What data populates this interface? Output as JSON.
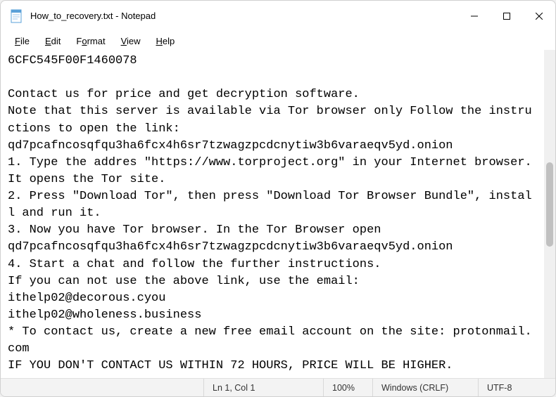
{
  "titlebar": {
    "filename": "How_to_recovery.txt",
    "appname": "Notepad",
    "full": "How_to_recovery.txt - Notepad"
  },
  "menu": {
    "file": "File",
    "edit": "Edit",
    "format": "Format",
    "view": "View",
    "help": "Help"
  },
  "body_text": "6CFC545F00F1460078\n\nContact us for price and get decryption software.\nNote that this server is available via Tor browser only Follow the instructions to open the link:\nqd7pcafncosqfqu3ha6fcx4h6sr7tzwagzpcdcnytiw3b6varaeqv5yd.onion\n1. Type the addres \"https://www.torproject.org\" in your Internet browser. It opens the Tor site.\n2. Press \"Download Tor\", then press \"Download Tor Browser Bundle\", install and run it.\n3. Now you have Tor browser. In the Tor Browser open\nqd7pcafncosqfqu3ha6fcx4h6sr7tzwagzpcdcnytiw3b6varaeqv5yd.onion\n4. Start a chat and follow the further instructions.\nIf you can not use the above link, use the email:\nithelp02@decorous.cyou\nithelp02@wholeness.business\n* To contact us, create a new free email account on the site: protonmail.com\nIF YOU DON'T CONTACT US WITHIN 72 HOURS, PRICE WILL BE HIGHER.",
  "status": {
    "position": "Ln 1, Col 1",
    "zoom": "100%",
    "line_ending": "Windows (CRLF)",
    "encoding": "UTF-8"
  }
}
